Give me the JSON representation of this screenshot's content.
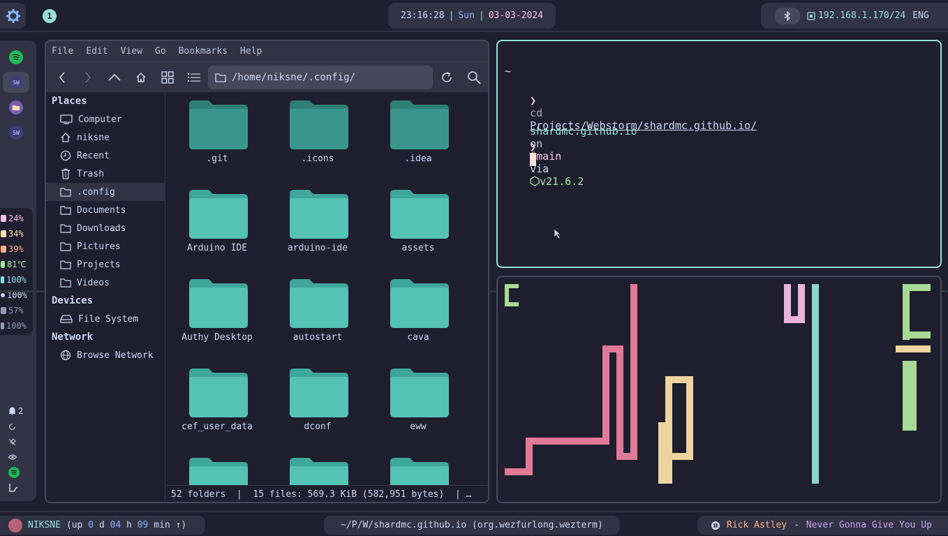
{
  "topbar": {
    "workspace": "1",
    "time": "23:16:28",
    "day": "Sun",
    "date": "03-03-2024",
    "ip": "192.168.1.170/24",
    "lang": "ENG"
  },
  "dock": {
    "apps": [
      {
        "name": "spotify",
        "label": ""
      },
      {
        "name": "webstorm",
        "label": "SW"
      },
      {
        "name": "files",
        "label": ""
      },
      {
        "name": "webstorm",
        "label": "SW"
      }
    ],
    "stats": [
      {
        "name": "cpu",
        "value": "24%",
        "color": "#f5c2e7"
      },
      {
        "name": "memory",
        "value": "34%",
        "color": "#f9e2af"
      },
      {
        "name": "disk",
        "value": "39%",
        "color": "#fab387"
      },
      {
        "name": "temperature",
        "value": "81℃",
        "color": "#a6e3a1"
      },
      {
        "name": "battery",
        "value": "100%",
        "color": "#89dceb"
      },
      {
        "name": "brightness",
        "value": "100%",
        "color": "#cdd6f4"
      },
      {
        "name": "headphones",
        "value": "57%",
        "color": "#bac2de"
      },
      {
        "name": "volume",
        "value": "100%",
        "color": "#bac2de"
      }
    ],
    "notifications": "2"
  },
  "filemanager": {
    "menu": [
      "File",
      "Edit",
      "View",
      "Go",
      "Bookmarks",
      "Help"
    ],
    "path": "/home/niksne/.config/",
    "sections": {
      "places": "Places",
      "devices": "Devices",
      "network": "Network"
    },
    "places": [
      "Computer",
      "niksne",
      "Recent",
      "Trash",
      ".config",
      "Documents",
      "Downloads",
      "Pictures",
      "Projects",
      "Videos"
    ],
    "devices": [
      "File System"
    ],
    "network": [
      "Browse Network"
    ],
    "folders": [
      ".git",
      ".icons",
      ".idea",
      "Arduino IDE",
      "arduino-ide",
      "assets",
      "Authy Desktop",
      "autostart",
      "cava",
      "cef_user_data",
      "dconf",
      "eww",
      "",
      "",
      ""
    ],
    "status": "52 folders  |  15 files: 569.3 KiB (582,951 bytes)  | …"
  },
  "terminal": {
    "line1": "~",
    "prompt_symbol": "❯",
    "cmd": "cd",
    "cmd_arg": "Projects/Webstorm/shardmc.github.io/",
    "dir": "shardmc.github.io",
    "on": "on",
    "branch_icon": "ᚴ",
    "branch": "main",
    "via": "via",
    "node_version": "v21.6.2"
  },
  "bottombar": {
    "user": "NIKSNE",
    "uptime_prefix": "(up",
    "days": "0",
    "d": "d",
    "hours": "04",
    "h": "h",
    "mins": "09",
    "min": "min",
    "uptime_suffix": "↑)",
    "window_title": "~/P/W/shardmc.github.io (org.wezfurlong.wezterm)",
    "artist": "Rick Astley",
    "dash": "-",
    "track": "Never Gonna Give You Up"
  },
  "colors": {
    "accent": "#94e2d5",
    "pink": "#e07a96",
    "green": "#a6da95",
    "yellow": "#eed49f",
    "folder": "#4fb0a6"
  }
}
